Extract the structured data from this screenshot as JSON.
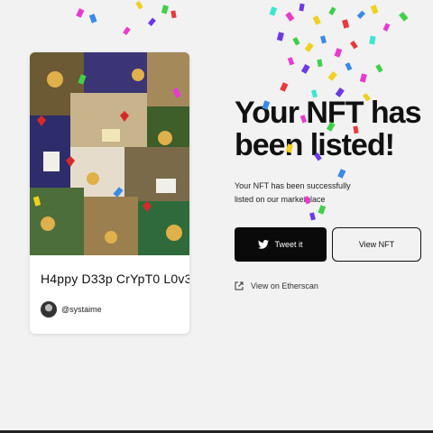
{
  "nft": {
    "title": "H4ppy D33p CrYpT0 L0v3",
    "creator": "@systaime"
  },
  "headline": "Your NFT has been listed!",
  "subtext": "Your NFT has been successfully listed on our marketplace",
  "actions": {
    "tweet_label": "Tweet it",
    "view_label": "View NFT",
    "etherscan_label": "View on Etherscan"
  },
  "colors": {
    "background": "#f2f2f2",
    "primary_button": "#0a0a0a",
    "text": "#111111"
  },
  "icons": {
    "tweet": "twitter-bird-icon",
    "etherscan": "external-link-icon"
  }
}
